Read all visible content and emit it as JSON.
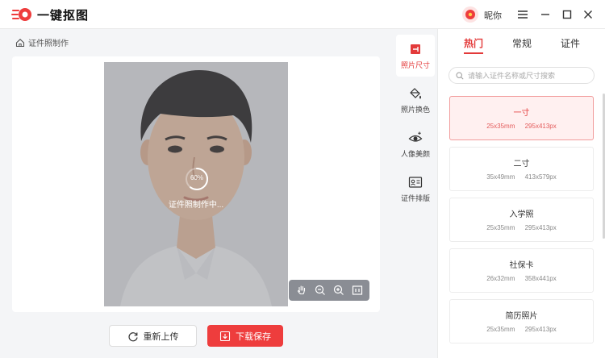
{
  "app": {
    "title": "一键抠图",
    "brand_color": "#ee3d3d",
    "nickname": "昵你"
  },
  "breadcrumb": {
    "label": "证件照制作"
  },
  "canvas": {
    "progress_percent_label": "60%",
    "progress_fraction": 0.6,
    "progress_text": "证件照制作中..."
  },
  "zoom_toolbar": [
    "hand-icon",
    "zoom-out-icon",
    "zoom-in-icon",
    "fit-icon"
  ],
  "actions": {
    "reupload": "重新上传",
    "download": "下载保存"
  },
  "tools": [
    {
      "label": "照片尺寸",
      "icon": "crop-icon",
      "active": true
    },
    {
      "label": "照片换色",
      "icon": "paint-bucket-icon",
      "active": false
    },
    {
      "label": "人像美颜",
      "icon": "eye-sparkle-icon",
      "active": false
    },
    {
      "label": "证件排版",
      "icon": "id-card-icon",
      "active": false
    }
  ],
  "panel": {
    "tabs": [
      {
        "label": "热门",
        "active": true
      },
      {
        "label": "常规",
        "active": false
      },
      {
        "label": "证件",
        "active": false
      }
    ],
    "search": {
      "placeholder": "请输入证件名称或尺寸搜索",
      "value": ""
    },
    "sizes": [
      {
        "name": "一寸",
        "mm": "25x35mm",
        "px": "295x413px",
        "selected": true
      },
      {
        "name": "二寸",
        "mm": "35x49mm",
        "px": "413x579px",
        "selected": false
      },
      {
        "name": "入学照",
        "mm": "25x35mm",
        "px": "295x413px",
        "selected": false
      },
      {
        "name": "社保卡",
        "mm": "26x32mm",
        "px": "358x441px",
        "selected": false
      },
      {
        "name": "简历照片",
        "mm": "25x35mm",
        "px": "295x413px",
        "selected": false
      }
    ]
  }
}
